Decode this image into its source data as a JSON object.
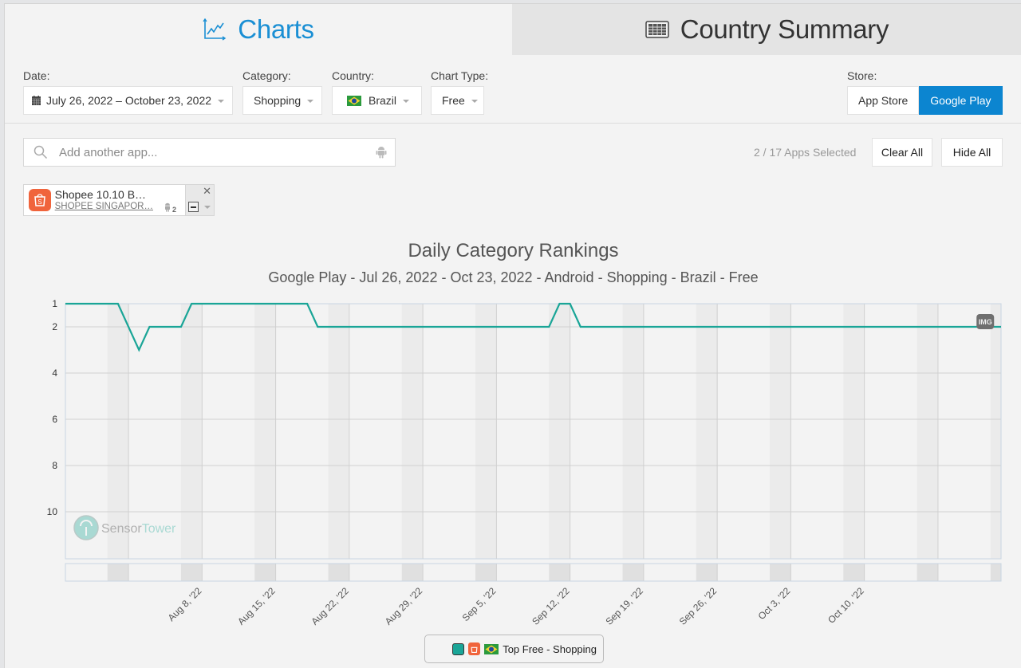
{
  "tabs": [
    {
      "label": "Charts",
      "icon": "line-chart-icon",
      "active": true
    },
    {
      "label": "Country Summary",
      "icon": "table-icon",
      "active": false
    }
  ],
  "filters": {
    "date": {
      "label": "Date:",
      "value": "July 26, 2022 – October 23, 2022"
    },
    "category": {
      "label": "Category:",
      "value": "Shopping"
    },
    "country": {
      "label": "Country:",
      "value": "Brazil",
      "flag": "brazil-flag"
    },
    "chart_type": {
      "label": "Chart Type:",
      "value": "Free"
    },
    "store": {
      "label": "Store:",
      "options": [
        "App Store",
        "Google Play"
      ],
      "selected": "Google Play"
    }
  },
  "search": {
    "placeholder": "Add another app..."
  },
  "selection": {
    "count_text": "2 / 17 Apps Selected",
    "clear_all": "Clear All",
    "hide_all": "Hide All"
  },
  "app_chip": {
    "name": "Shopee 10.10 B…",
    "developer": "SHOPEE SINGAPOR…",
    "device_count": "2"
  },
  "colors": {
    "accent": "#0c85d0",
    "series": "#1aa597",
    "app_icon": "#f0643c"
  },
  "watermark": {
    "part1": "Sensor",
    "part2": "Tower"
  },
  "marker_label": "IMG",
  "chart_data": {
    "type": "line",
    "title": "Daily Category Rankings",
    "subtitle": "Google Play - Jul 26, 2022 - Oct 23, 2022 - Android - Shopping - Brazil - Free",
    "xlabel": "",
    "ylabel": "",
    "x_start": "2022-07-26",
    "x_end": "2022-10-23",
    "y_inverted": true,
    "ylim": [
      1,
      11
    ],
    "y_ticks": [
      1,
      2,
      4,
      6,
      8,
      10
    ],
    "x_ticks": [
      "Aug 8, '22",
      "Aug 15, '22",
      "Aug 22, '22",
      "Aug 29, '22",
      "Sep 5, '22",
      "Sep 12, '22",
      "Sep 19, '22",
      "Sep 26, '22",
      "Oct 3, '22",
      "Oct 10, '22"
    ],
    "grid": true,
    "weekends_shaded": true,
    "legend": {
      "position": "bottom",
      "entries": [
        "Top Free - Shopping"
      ]
    },
    "series": [
      {
        "name": "Top Free - Shopping",
        "points": [
          {
            "date": "2022-07-26",
            "rank": 1
          },
          {
            "date": "2022-07-31",
            "rank": 1
          },
          {
            "date": "2022-08-02",
            "rank": 3
          },
          {
            "date": "2022-08-03",
            "rank": 2
          },
          {
            "date": "2022-08-06",
            "rank": 2
          },
          {
            "date": "2022-08-07",
            "rank": 1
          },
          {
            "date": "2022-08-18",
            "rank": 1
          },
          {
            "date": "2022-08-19",
            "rank": 2
          },
          {
            "date": "2022-09-10",
            "rank": 2
          },
          {
            "date": "2022-09-11",
            "rank": 1
          },
          {
            "date": "2022-09-12",
            "rank": 1
          },
          {
            "date": "2022-09-13",
            "rank": 2
          },
          {
            "date": "2022-10-23",
            "rank": 2
          }
        ]
      }
    ]
  }
}
